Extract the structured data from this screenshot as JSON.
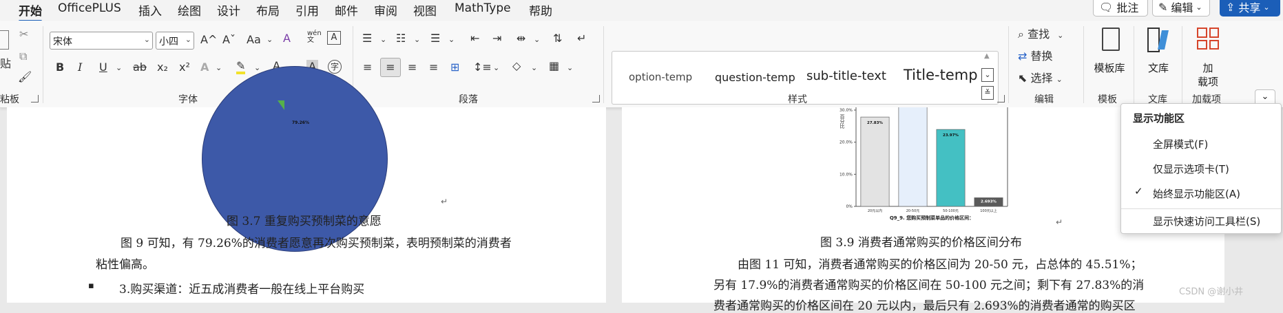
{
  "tabs": [
    "开始",
    "OfficePLUS",
    "插入",
    "绘图",
    "设计",
    "布局",
    "引用",
    "邮件",
    "审阅",
    "视图",
    "MathType",
    "帮助"
  ],
  "top_buttons": {
    "comment": "批注",
    "edit": "编辑",
    "share": "共享"
  },
  "ribbon": {
    "clipboard": {
      "label": "粘板",
      "paste": "贴"
    },
    "font": {
      "label": "字体",
      "font_name": "宋体",
      "font_size": "小四",
      "grow": "A^",
      "shrink": "Aˇ",
      "case": "Aa",
      "phonetic_top": "wén",
      "phonetic_bottom": "文",
      "bold": "B",
      "italic": "I",
      "underline": "U",
      "strike": "ab",
      "sub": "x₂",
      "sup": "x²"
    },
    "paragraph": {
      "label": "段落"
    },
    "styles": {
      "label": "样式",
      "items": [
        "option-temp",
        "question-temp",
        "sub-title-text",
        "Title-temp"
      ]
    },
    "editing": {
      "label": "编辑",
      "find": "查找",
      "replace": "替换",
      "select": "选择"
    },
    "templates": {
      "label": "模板",
      "button": "模板库"
    },
    "library": {
      "label": "文库",
      "button": "文库"
    },
    "addins": {
      "label": "加载项",
      "button_line1": "加",
      "button_line2": "载项"
    }
  },
  "left_page": {
    "pie_label": "79.26%",
    "caption": "图 3.7  重复购买预制菜的意愿",
    "para1": "图 9 可知，有 79.26%的消费者愿意再次购买预制菜，表明预制菜的消费者",
    "para2": "粘性偏高。",
    "bullet": "▪",
    "bullet_text": "3.购买渠道：近五成消费者一般在线上平台购买"
  },
  "right_page": {
    "caption": "图 3.9 消费者通常购买的价格区间分布",
    "para1": "由图 11 可知，消费者通常购买的价格区间为 20-50 元，占总体的 45.51%；",
    "para2": "另有 17.9%的消费者通常购买的价格区间在 50-100 元之间；剩下有 27.83%的消",
    "para3": "费者通常购买的价格区间在 20 元以内，最后只有 2.693%的消费者通常的购买区"
  },
  "chart_data": {
    "type": "bar",
    "title": "Q9_9. 您购买预制菜单品的价格区间：",
    "ylabel": "百分比",
    "categories": [
      "20元以内",
      "20-50元",
      "50-100元",
      "100元以上"
    ],
    "values": [
      27.83,
      45.51,
      23.97,
      2.693
    ],
    "value_labels": [
      "27.83%",
      "",
      "23.97%",
      "2.693%"
    ],
    "yticks": [
      "0%",
      "10.0%",
      "20.0%",
      "30.0%"
    ],
    "ylim": [
      0,
      30
    ],
    "colors": [
      "#e3e3e3",
      "#e6effb",
      "#44c0c3",
      "#5a5a5a"
    ]
  },
  "dropdown": {
    "header": "显示功能区",
    "items": [
      {
        "label": "全屏模式(F)",
        "checked": false
      },
      {
        "label": "仅显示选项卡(T)",
        "checked": false
      },
      {
        "label": "始终显示功能区(A)",
        "checked": true
      },
      {
        "label": "显示快速访问工具栏(S)",
        "checked": false
      }
    ]
  },
  "watermark": "CSDN @谢小井"
}
